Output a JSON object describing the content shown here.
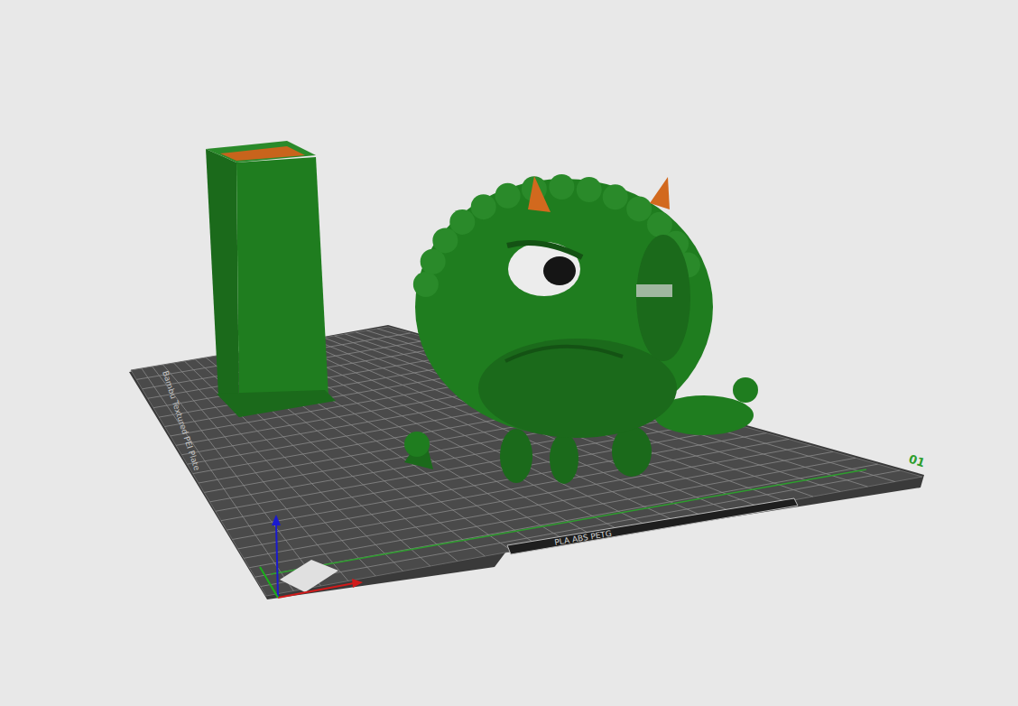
{
  "plate": {
    "number": "01",
    "name": "Bambu Textured PEI Plate",
    "label": "PLA ABS PETG"
  }
}
